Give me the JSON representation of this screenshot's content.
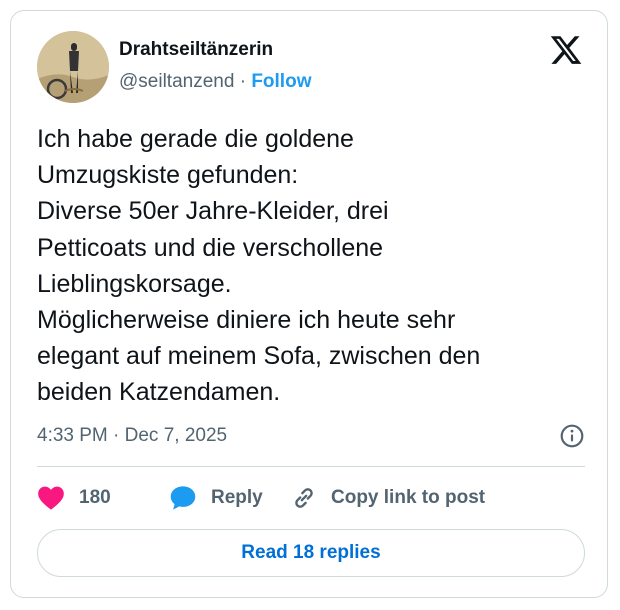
{
  "author": {
    "display_name": "Drahtseiltänzerin",
    "handle": "@seiltanzend",
    "separator": "·",
    "follow_label": "Follow"
  },
  "tweet": {
    "lines": [
      "Ich habe gerade die goldene",
      "Umzugskiste gefunden:",
      "Diverse 50er Jahre-Kleider, drei",
      "Petticoats und die verschollene",
      "Lieblingskorsage.",
      "Möglicherweise diniere ich heute sehr",
      "elegant auf meinem Sofa, zwischen den",
      "beiden Katzendamen."
    ],
    "timestamp": "4:33 PM · Dec 7, 2025"
  },
  "actions": {
    "like_count": "180",
    "reply_label": "Reply",
    "copy_label": "Copy link to post",
    "read_replies_label": "Read 18 replies"
  },
  "icons": {
    "brand": "x-logo-icon",
    "like": "heart-icon",
    "reply": "speech-bubble-icon",
    "copy": "link-icon",
    "info": "info-icon"
  },
  "colors": {
    "like": "#f91880",
    "reply": "#1d9bf0",
    "link_text": "#006fd6",
    "secondary_text": "#536471"
  }
}
